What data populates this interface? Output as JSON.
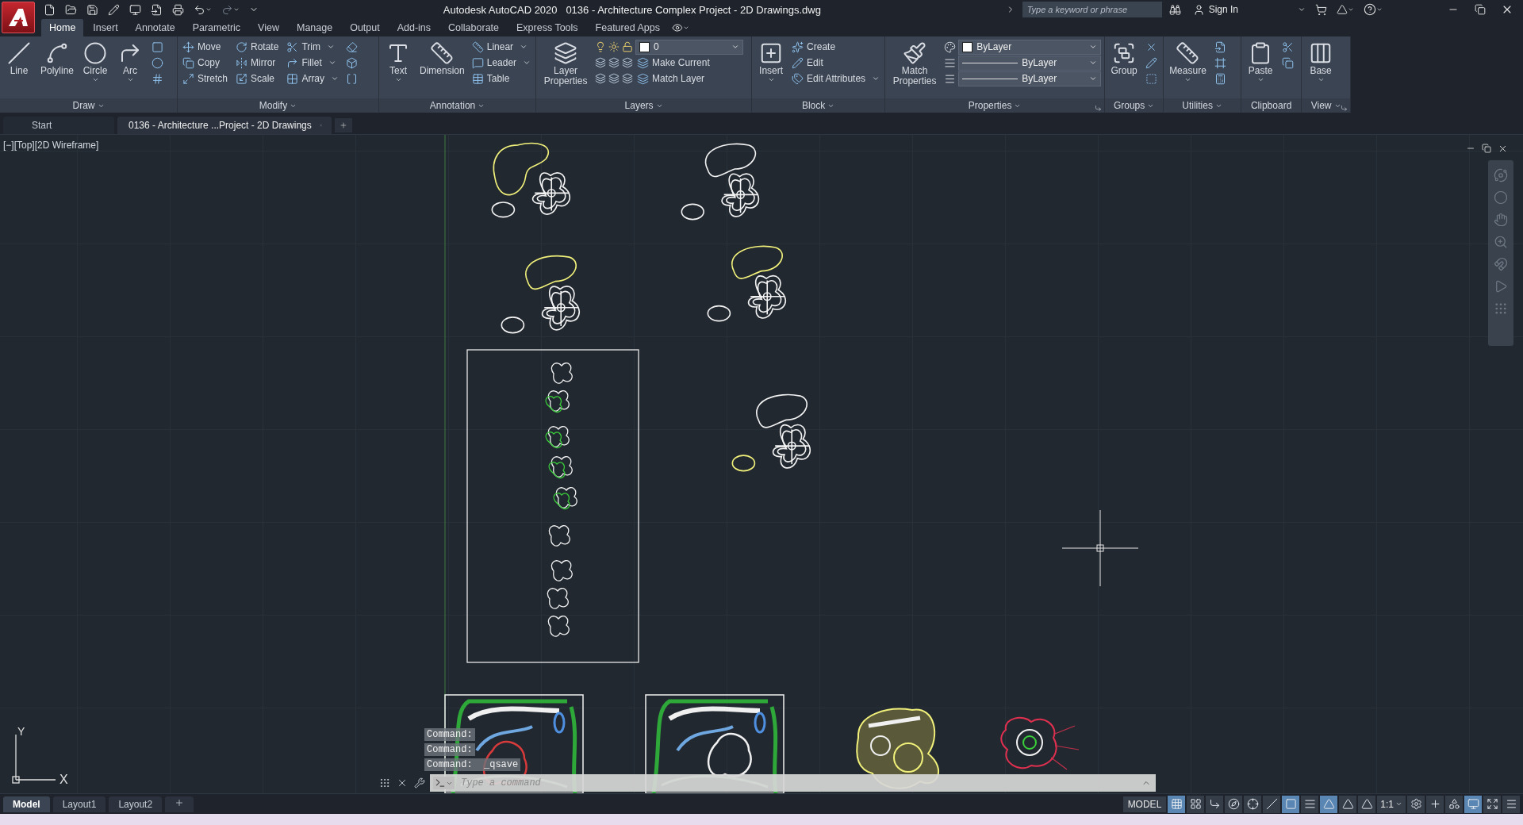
{
  "title_bar": {
    "app": "Autodesk AutoCAD 2020",
    "document": "0136 - Architecture Complex Project - 2D Drawings.dwg",
    "search": {
      "placeholder": "Type a keyword or phrase"
    },
    "sign_in": "Sign In"
  },
  "ribbon_tabs": [
    {
      "label": "Home",
      "selected": true
    },
    {
      "label": "Insert",
      "selected": false
    },
    {
      "label": "Annotate",
      "selected": false
    },
    {
      "label": "Parametric",
      "selected": false
    },
    {
      "label": "View",
      "selected": false
    },
    {
      "label": "Manage",
      "selected": false
    },
    {
      "label": "Output",
      "selected": false
    },
    {
      "label": "Add-ins",
      "selected": false
    },
    {
      "label": "Collaborate",
      "selected": false
    },
    {
      "label": "Express Tools",
      "selected": false
    },
    {
      "label": "Featured Apps",
      "selected": false
    }
  ],
  "panels": [
    {
      "kind": "buttons",
      "title": "Draw",
      "menu": true,
      "large": [
        {
          "label": "Line",
          "dropdown": false
        },
        {
          "label": "Polyline",
          "dropdown": false
        },
        {
          "label": "Circle",
          "dropdown": true
        },
        {
          "label": "Arc",
          "dropdown": true
        }
      ]
    },
    {
      "kind": "buttons",
      "title": "Modify",
      "menu": true,
      "small": [
        {
          "label": "Move",
          "dropdown": false
        },
        {
          "label": "Rotate",
          "dropdown": false
        },
        {
          "label": "Trim",
          "dropdown": true
        },
        {
          "label": "Copy",
          "dropdown": false
        },
        {
          "label": "Mirror",
          "dropdown": false
        },
        {
          "label": "Fillet",
          "dropdown": true
        },
        {
          "label": "Stretch",
          "dropdown": false
        },
        {
          "label": "Scale",
          "dropdown": false
        },
        {
          "label": "Array",
          "dropdown": true
        }
      ]
    },
    {
      "kind": "buttons",
      "title": "Annotation",
      "menu": true,
      "large": [
        {
          "label": "Text",
          "dropdown": true
        },
        {
          "label": "Dimension",
          "dropdown": false
        }
      ],
      "small": [
        {
          "label": "Linear",
          "dropdown": true
        },
        {
          "label": "Leader",
          "dropdown": true
        },
        {
          "label": "Table",
          "dropdown": false
        }
      ]
    },
    {
      "kind": "layers",
      "title": "Layers",
      "menu": true,
      "large": [
        {
          "label": "Layer Properties",
          "dropdown": false
        }
      ],
      "layer": {
        "value": "0"
      },
      "small": [
        {
          "label": "Make Current",
          "dropdown": false
        },
        {
          "label": "Match Layer",
          "dropdown": false
        }
      ]
    },
    {
      "kind": "buttons",
      "title": "Block",
      "menu": true,
      "large": [
        {
          "label": "Insert",
          "dropdown": true
        }
      ],
      "small": [
        {
          "label": "Create",
          "dropdown": false
        },
        {
          "label": "Edit",
          "dropdown": false
        },
        {
          "label": "Edit Attributes",
          "dropdown": true
        }
      ]
    },
    {
      "kind": "properties",
      "title": "Properties",
      "menu": true,
      "large": [
        {
          "label": "Match Properties",
          "dropdown": false
        }
      ],
      "fields": [
        {
          "kind": "color",
          "value": "ByLayer"
        },
        {
          "kind": "lineweight",
          "value": "ByLayer"
        },
        {
          "kind": "linetype",
          "value": "ByLayer"
        }
      ]
    },
    {
      "kind": "buttons",
      "title": "Groups",
      "menu": true,
      "large": [
        {
          "label": "Group",
          "dropdown": false
        }
      ]
    },
    {
      "kind": "buttons",
      "title": "Utilities",
      "menu": true,
      "large": [
        {
          "label": "Measure",
          "dropdown": true
        }
      ]
    },
    {
      "kind": "buttons",
      "title": "Clipboard",
      "menu": false,
      "large": [
        {
          "label": "Paste",
          "dropdown": true
        }
      ]
    },
    {
      "kind": "buttons",
      "title": "View",
      "menu": true,
      "large": [
        {
          "label": "Base",
          "dropdown": true
        }
      ]
    }
  ],
  "doc_tabs": [
    {
      "label": "Start",
      "selected": false,
      "closable": false
    },
    {
      "label": "0136 - Architecture ...Project - 2D Drawings",
      "selected": true,
      "closable": true
    }
  ],
  "viewport": {
    "label": "[−][Top][2D Wireframe]",
    "ucs": {
      "x": "X",
      "y": "Y"
    }
  },
  "command_history": [
    "Command:",
    "Command:",
    "Command:  _qsave"
  ],
  "command_line": {
    "placeholder": "Type a command"
  },
  "layout_tabs": [
    {
      "label": "Model",
      "selected": true
    },
    {
      "label": "Layout1",
      "selected": false
    },
    {
      "label": "Layout2",
      "selected": false
    }
  ],
  "status_bar": {
    "model": "MODEL",
    "toggles_left": [
      {
        "on": true
      },
      {
        "on": false
      },
      {
        "on": false
      },
      {
        "on": false
      },
      {
        "on": false
      },
      {
        "on": false
      },
      {
        "on": true
      },
      {
        "on": false
      },
      {
        "on": true
      },
      {
        "on": false
      },
      {
        "on": false
      }
    ],
    "scale": "1:1",
    "toggles_right": [
      {
        "on": false
      },
      {
        "on": false
      },
      {
        "on": false
      },
      {
        "on": true
      },
      {
        "on": false
      },
      {
        "on": false
      }
    ]
  }
}
